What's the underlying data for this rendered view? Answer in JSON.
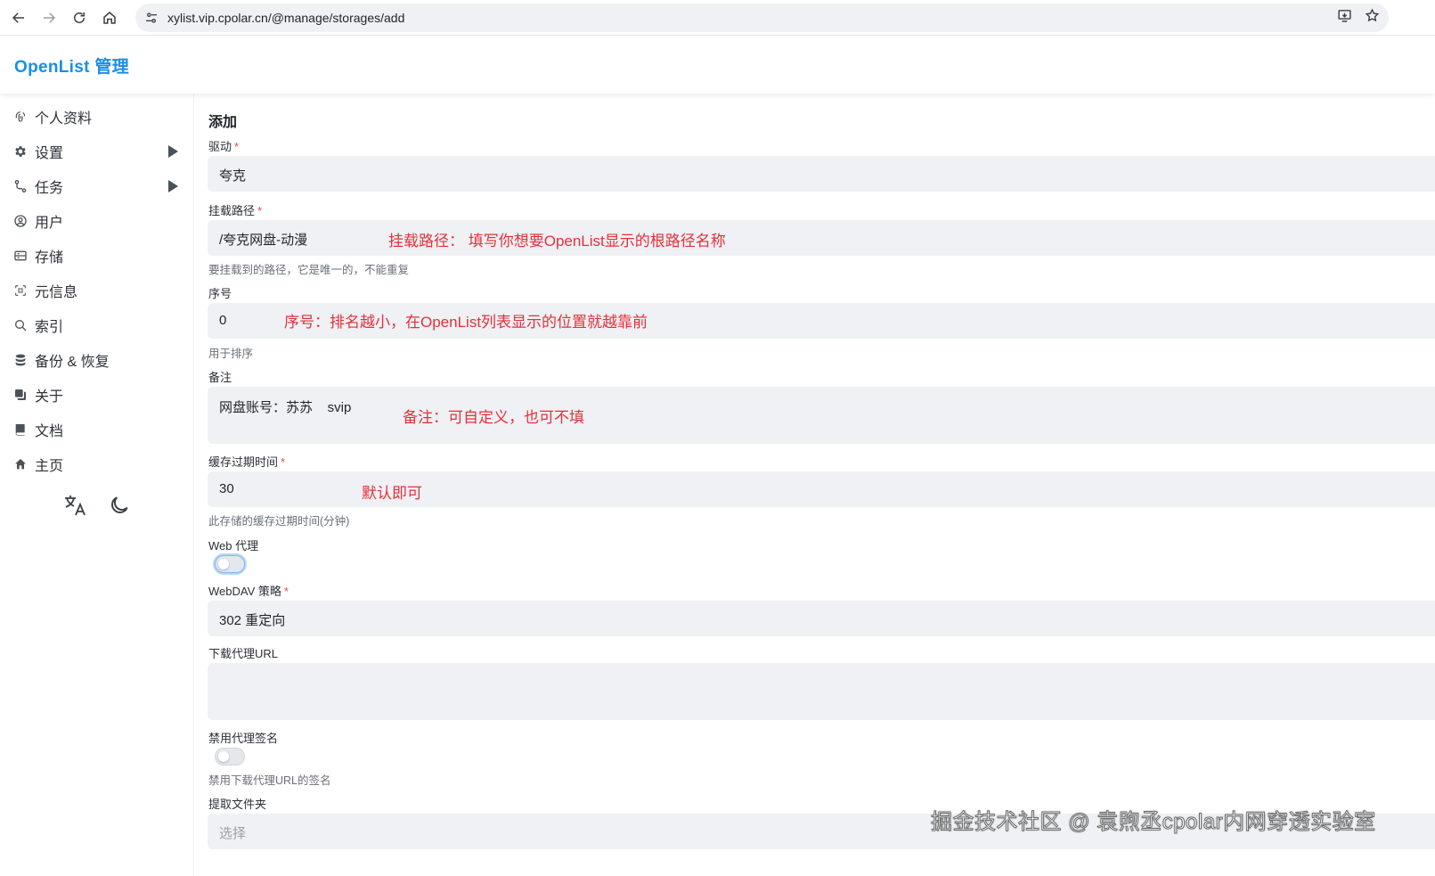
{
  "browser": {
    "url": "xylist.vip.cpolar.cn/@manage/storages/add"
  },
  "header": {
    "brand": "OpenList 管理"
  },
  "sidebar": {
    "items": [
      {
        "label": "个人资料",
        "icon": "fingerprint-icon",
        "expandable": false
      },
      {
        "label": "设置",
        "icon": "gear-icon",
        "expandable": true
      },
      {
        "label": "任务",
        "icon": "route-icon",
        "expandable": true
      },
      {
        "label": "用户",
        "icon": "user-circle-icon",
        "expandable": false
      },
      {
        "label": "存储",
        "icon": "storage-icon",
        "expandable": false
      },
      {
        "label": "元信息",
        "icon": "metadata-icon",
        "expandable": false
      },
      {
        "label": "索引",
        "icon": "search-icon",
        "expandable": false
      },
      {
        "label": "备份 & 恢复",
        "icon": "database-icon",
        "expandable": false
      },
      {
        "label": "关于",
        "icon": "copy-icon",
        "expandable": false
      },
      {
        "label": "文档",
        "icon": "book-icon",
        "expandable": false
      },
      {
        "label": "主页",
        "icon": "home-icon",
        "expandable": false
      }
    ],
    "tools": [
      "translate-icon",
      "moon-icon"
    ]
  },
  "form": {
    "title": "添加",
    "driver": {
      "label": "驱动",
      "value": "夸克"
    },
    "mount_path": {
      "label": "挂载路径",
      "value": "/夸克网盘-动漫",
      "help": "要挂载到的路径，它是唯一的，不能重复",
      "annotation": "挂载路径：  填写你想要OpenList显示的根路径名称"
    },
    "order": {
      "label": "序号",
      "value": "0",
      "help": "用于排序",
      "annotation": "序号：排名越小，在OpenList列表显示的位置就越靠前"
    },
    "remark": {
      "label": "备注",
      "value": "网盘账号：苏苏    svip",
      "annotation": "备注：可自定义，也可不填"
    },
    "cache_expiration": {
      "label": "缓存过期时间",
      "value": "30",
      "help": "此存储的缓存过期时间(分钟)",
      "annotation": "默认即可"
    },
    "web_proxy": {
      "label": "Web 代理",
      "enabled": false
    },
    "webdav_policy": {
      "label": "WebDAV 策略",
      "value": "302 重定向"
    },
    "download_proxy_url": {
      "label": "下载代理URL",
      "value": ""
    },
    "disable_proxy_sign": {
      "label": "禁用代理签名",
      "enabled": false,
      "help": "禁用下载代理URL的签名"
    },
    "extract_folder": {
      "label": "提取文件夹",
      "placeholder": "选择"
    }
  },
  "watermark": "掘金技术社区 @ 袁煦丞cpolar内网穿透实验室",
  "colors": {
    "brand": "#1a8fe6",
    "required": "#e5484d",
    "annotation": "#e5303a"
  }
}
